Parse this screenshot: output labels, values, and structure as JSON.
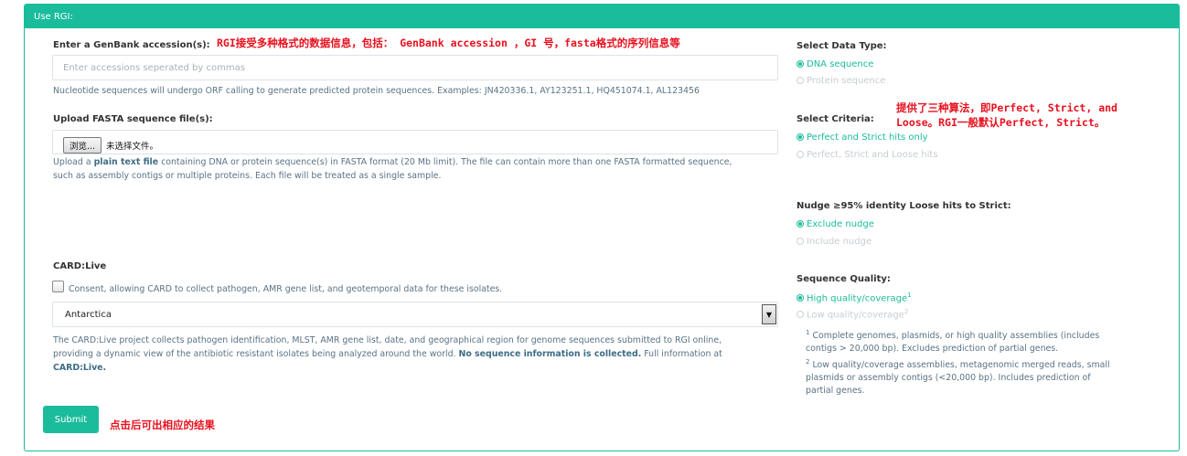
{
  "panel": {
    "title": "Use RGI:"
  },
  "genbank": {
    "label": "Enter a GenBank accession(s):",
    "placeholder": "Enter accessions seperated by commas",
    "help": "Nucleotide sequences will undergo ORF calling to generate predicted protein sequences. Examples: JN420336.1, AY123251.1, HQ451074.1, AL123456"
  },
  "fasta": {
    "label": "Upload FASTA sequence file(s):",
    "browse_button": "浏览...",
    "no_file_text": "未选择文件。",
    "help_prefix": "Upload a ",
    "help_bold": "plain text file",
    "help_line1_rest": " containing DNA or protein sequence(s) in FASTA format (20 Mb limit). The file can contain more than one FASTA formatted sequence,",
    "help_line2": "such as assembly contigs or multiple proteins. Each file will be treated as a single sample."
  },
  "cardlive": {
    "label": "CARD:Live",
    "consent": "Consent, allowing CARD to collect pathogen, AMR gene list, and geotemporal data for these isolates.",
    "region_selected": "Antarctica",
    "help_line1": "The CARD:Live project collects pathogen identification, MLST, AMR gene list, date, and geographical region for genome sequences submitted to RGI online,",
    "help_line2_prefix": "providing a dynamic view of the antibiotic resistant isolates being analyzed around the world. ",
    "help_line2_bold": "No sequence information is collected.",
    "help_line2_suffix": " Full information at",
    "help_link": "CARD:Live."
  },
  "submit": {
    "label": "Submit"
  },
  "data_type": {
    "label": "Select Data Type:",
    "options": [
      {
        "label": "DNA sequence",
        "selected": true
      },
      {
        "label": "Protein sequence",
        "selected": false
      }
    ]
  },
  "criteria": {
    "label": "Select Criteria:",
    "options": [
      {
        "label": "Perfect and Strict hits only",
        "selected": true
      },
      {
        "label": "Perfect, Strict and Loose hits",
        "selected": false
      }
    ]
  },
  "nudge": {
    "label": "Nudge ≥95% identity Loose hits to Strict:",
    "options": [
      {
        "label": "Exclude nudge",
        "selected": true
      },
      {
        "label": "Include nudge",
        "selected": false
      }
    ]
  },
  "quality": {
    "label": "Sequence Quality:",
    "options": [
      {
        "label": "High quality/coverage",
        "sup": "1",
        "selected": true
      },
      {
        "label": "Low quality/coverage",
        "sup": "2",
        "selected": false
      }
    ],
    "footnote1_num": "1",
    "footnote1_line1": " Complete genomes, plasmids, or high quality assemblies (includes",
    "footnote1_line2": "contigs > 20,000 bp). Excludes prediction of partial genes.",
    "footnote2_num": "2",
    "footnote2_line1": " Low quality/coverage assemblies, metagenomic merged reads, small",
    "footnote2_line2": "plasmids or assembly contigs (<20,000 bp). Includes prediction of",
    "footnote2_line3": "partial genes."
  },
  "annotations": {
    "formats": "RGI接受多种格式的数据信息，包括： GenBank accession ，GI 号，fasta格式的序列信息等",
    "criteria_line1": "提供了三种算法，即Perfect, Strict, and",
    "criteria_line2": "Loose。RGI一般默认Perfect, Strict。",
    "submit": "点击后可出相应的结果"
  },
  "colors": {
    "accent": "#1abc9c",
    "annotation": "#e8101e"
  }
}
